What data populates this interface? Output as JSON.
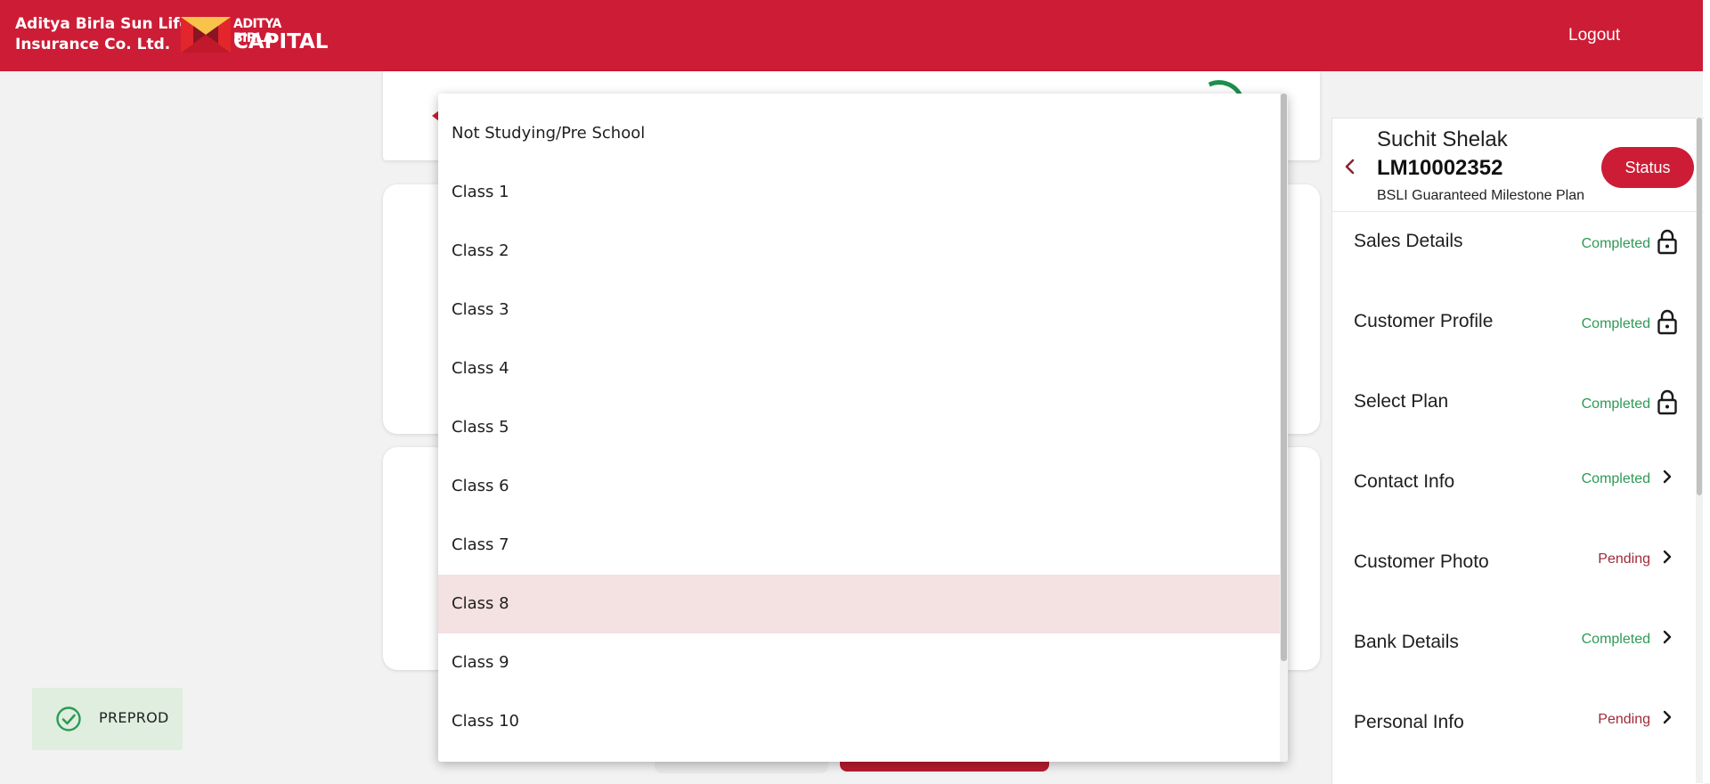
{
  "header": {
    "brand_line1": "Aditya Birla Sun Life",
    "brand_line2": "Insurance Co. Ltd.",
    "logo_line1": "ADITYA BIRLA",
    "logo_line2": "CAPITAL",
    "logout_label": "Logout",
    "color": "#cd1c35"
  },
  "badge": {
    "label": "PREPROD",
    "icon": "check-circle-icon"
  },
  "dropdown": {
    "options": [
      "Not Studying/Pre School",
      "Class 1",
      "Class 2",
      "Class 3",
      "Class 4",
      "Class 5",
      "Class 6",
      "Class 7",
      "Class 8",
      "Class 9",
      "Class 10"
    ],
    "selected": "Class 8"
  },
  "panel": {
    "name": "Suchit Shelak",
    "lead_id": "LM10002352",
    "plan": "BSLI Guaranteed Milestone Plan",
    "status_label": "Status",
    "steps": [
      {
        "label": "Sales Details",
        "status": "Completed",
        "icon": "lock-icon"
      },
      {
        "label": "Customer Profile",
        "status": "Completed",
        "icon": "lock-icon"
      },
      {
        "label": "Select Plan",
        "status": "Completed",
        "icon": "lock-icon"
      },
      {
        "label": "Contact Info",
        "status": "Completed",
        "icon": "chevron-right-icon"
      },
      {
        "label": "Customer Photo",
        "status": "Pending",
        "icon": "chevron-right-icon"
      },
      {
        "label": "Bank Details",
        "status": "Completed",
        "icon": "chevron-right-icon"
      },
      {
        "label": "Personal Info",
        "status": "Pending",
        "icon": "chevron-right-icon"
      }
    ],
    "completed_color": "#2d9b55",
    "pending_color": "#9e2a3a"
  }
}
